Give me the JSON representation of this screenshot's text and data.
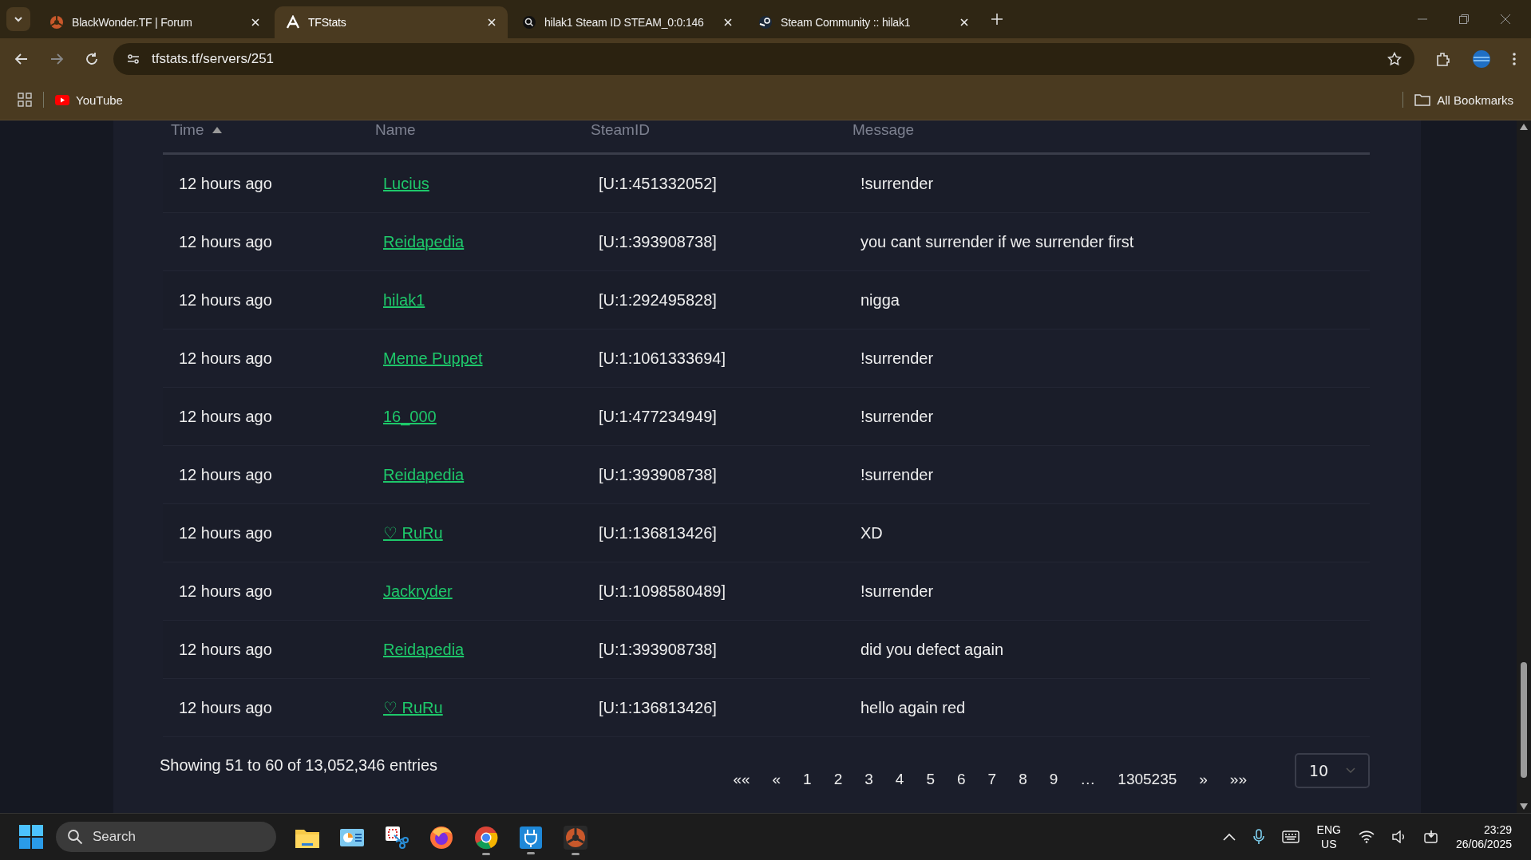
{
  "browser": {
    "tabs": [
      {
        "title": "BlackWonder.TF | Forum",
        "kind": "tf",
        "selected": false
      },
      {
        "title": "TFStats",
        "kind": "a",
        "selected": true
      },
      {
        "title": "hilak1 Steam ID STEAM_0:0:146",
        "kind": "search",
        "selected": false
      },
      {
        "title": "Steam Community :: hilak1",
        "kind": "steam",
        "selected": false
      }
    ],
    "address": "tfstats.tf/servers/251",
    "bookmarks": [
      "YouTube"
    ],
    "all_bookmarks": "All Bookmarks"
  },
  "table": {
    "columns": [
      {
        "label": "Time",
        "sorted": true
      },
      {
        "label": "Name",
        "sorted": false
      },
      {
        "label": "SteamID",
        "sorted": false
      },
      {
        "label": "Message",
        "sorted": false
      }
    ],
    "rows": [
      {
        "time": "12 hours ago",
        "name": "Lucius",
        "steamid": "[U:1:451332052]",
        "message": "!surrender"
      },
      {
        "time": "12 hours ago",
        "name": "Reidapedia",
        "steamid": "[U:1:393908738]",
        "message": "you cant surrender if we surrender first"
      },
      {
        "time": "12 hours ago",
        "name": "hilak1",
        "steamid": "[U:1:292495828]",
        "message": "nigga"
      },
      {
        "time": "12 hours ago",
        "name": "Meme Puppet",
        "steamid": "[U:1:1061333694]",
        "message": "!surrender"
      },
      {
        "time": "12 hours ago",
        "name": "16_000",
        "steamid": "[U:1:477234949]",
        "message": "!surrender"
      },
      {
        "time": "12 hours ago",
        "name": "Reidapedia",
        "steamid": "[U:1:393908738]",
        "message": "!surrender"
      },
      {
        "time": "12 hours ago",
        "name": "♡ RuRu",
        "steamid": "[U:1:136813426]",
        "message": "XD"
      },
      {
        "time": "12 hours ago",
        "name": "Jackryder",
        "steamid": "[U:1:1098580489]",
        "message": "!surrender"
      },
      {
        "time": "12 hours ago",
        "name": "Reidapedia",
        "steamid": "[U:1:393908738]",
        "message": "did you defect again"
      },
      {
        "time": "12 hours ago",
        "name": "♡ RuRu",
        "steamid": "[U:1:136813426]",
        "message": "hello again red"
      }
    ]
  },
  "footer": {
    "summary": "Showing 51 to 60 of 13,052,346 entries",
    "pagination": [
      "««",
      "«",
      "1",
      "2",
      "3",
      "4",
      "5",
      "6",
      "7",
      "8",
      "9",
      "…",
      "1305235",
      "»",
      "»»"
    ],
    "page_size": "10"
  },
  "taskbar": {
    "search": "Search",
    "apps": [
      {
        "kind": "folder",
        "running": false
      },
      {
        "kind": "control",
        "running": false
      },
      {
        "kind": "snip",
        "running": false
      },
      {
        "kind": "firefox",
        "running": false
      },
      {
        "kind": "chrome",
        "running": true
      },
      {
        "kind": "plug",
        "running": true
      },
      {
        "kind": "tf",
        "running": true
      }
    ],
    "language": [
      "ENG",
      "US"
    ],
    "time": "23:29",
    "date": "26/06/2025"
  }
}
